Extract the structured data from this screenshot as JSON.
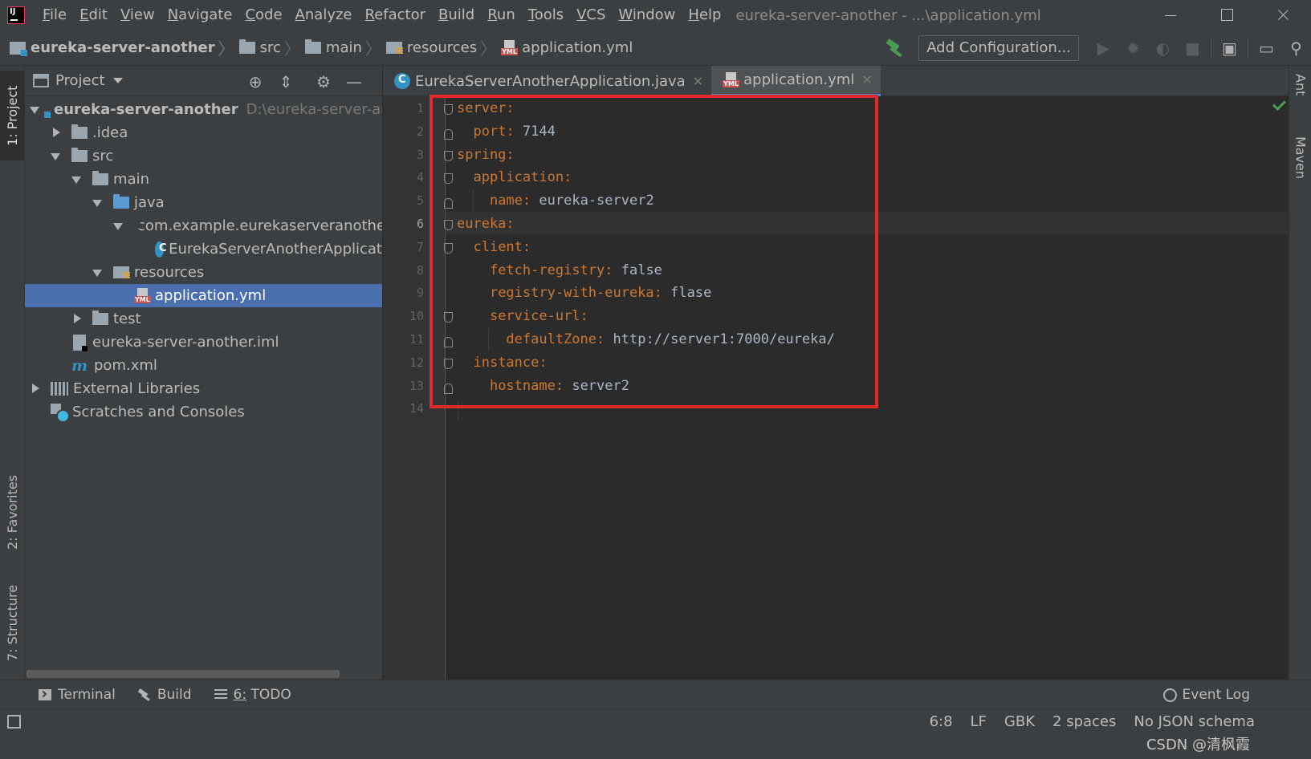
{
  "menu": {
    "items": [
      "File",
      "Edit",
      "View",
      "Navigate",
      "Code",
      "Analyze",
      "Refactor",
      "Build",
      "Run",
      "Tools",
      "VCS",
      "Window",
      "Help"
    ],
    "window_title": "eureka-server-another - ...\\application.yml"
  },
  "breadcrumb": {
    "items": [
      "eureka-server-another",
      "src",
      "main",
      "resources",
      "application.yml"
    ]
  },
  "toolbar": {
    "add_configuration": "Add Configuration..."
  },
  "left_strip": {
    "project": "1: Project",
    "favorites": "2: Favorites",
    "structure": "7: Structure"
  },
  "right_strip": {
    "ant": "Ant",
    "maven": "Maven"
  },
  "project_panel": {
    "title": "Project",
    "tree": {
      "root": "eureka-server-another",
      "root_path": "D:\\eureka-server-anc",
      "idea": ".idea",
      "src": "src",
      "main": "main",
      "java": "java",
      "package": "com.example.eurekaserveranothe",
      "main_class": "EurekaServerAnotherApplicat",
      "resources": "resources",
      "application_yml": "application.yml",
      "test": "test",
      "iml": "eureka-server-another.iml",
      "pom": "pom.xml",
      "external_libraries": "External Libraries",
      "scratches": "Scratches and Consoles"
    }
  },
  "editor_tabs": [
    {
      "label": "EurekaServerAnotherApplication.java",
      "active": false
    },
    {
      "label": "application.yml",
      "active": true
    }
  ],
  "editor": {
    "line_numbers": [
      "1",
      "2",
      "3",
      "4",
      "5",
      "6",
      "7",
      "8",
      "9",
      "10",
      "11",
      "12",
      "13",
      "14"
    ],
    "current_line": 6,
    "lines": [
      {
        "indent": "",
        "key": "server",
        "value": ""
      },
      {
        "indent": "  ",
        "key": "port",
        "value": "7144"
      },
      {
        "indent": "",
        "key": "spring",
        "value": ""
      },
      {
        "indent": "  ",
        "key": "application",
        "value": ""
      },
      {
        "indent": "    ",
        "key": "name",
        "value": "eureka-server2"
      },
      {
        "indent": "",
        "key": "eureka",
        "value": ""
      },
      {
        "indent": "  ",
        "key": "client",
        "value": ""
      },
      {
        "indent": "    ",
        "key": "fetch-registry",
        "value": "false"
      },
      {
        "indent": "    ",
        "key": "registry-with-eureka",
        "value": "flase"
      },
      {
        "indent": "    ",
        "key": "service-url",
        "value": ""
      },
      {
        "indent": "      ",
        "key": "defaultZone",
        "value": "http://server1:7000/eureka/"
      },
      {
        "indent": "  ",
        "key": "instance",
        "value": ""
      },
      {
        "indent": "    ",
        "key": "hostname",
        "value": "server2"
      },
      {
        "indent": "",
        "key": "",
        "value": ""
      }
    ],
    "highlight_color": "#e0292b"
  },
  "bottom_tools": {
    "terminal": "Terminal",
    "build": "Build",
    "todo": "6: TODO",
    "event_log": "Event Log"
  },
  "statusbar": {
    "position": "6:8",
    "line_sep": "LF",
    "encoding": "GBK",
    "indent": "2 spaces",
    "schema": "No JSON schema",
    "watermark": "CSDN @清枫霞"
  },
  "colors": {
    "accent": "#4a88c7",
    "selection": "#4b6eaf",
    "yaml_key": "#cc7832",
    "yaml_value": "#a9b7c6"
  }
}
